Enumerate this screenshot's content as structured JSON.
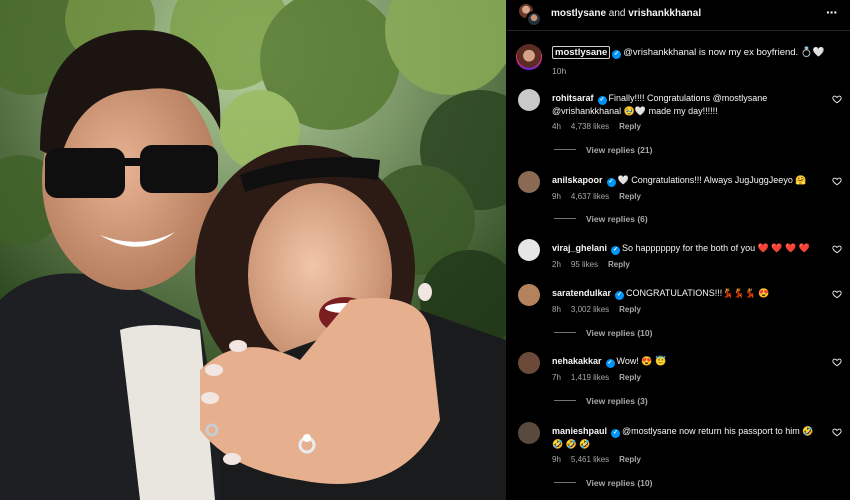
{
  "post": {
    "header": {
      "user1": "mostlysane",
      "joiner": " and ",
      "user2": "vrishankkhanal",
      "more_icon": "more-horizontal-icon"
    },
    "caption": {
      "username": "mostlysane",
      "text": "@vrishankkhanal is now my ex boyfriend. 💍🤍",
      "time": "10h"
    }
  },
  "comments": [
    {
      "username": "rohitsaraf",
      "verified": true,
      "text": "Finally!!!! Congratulations @mostlysane @vrishankkhanal 🥹🤍 made my day!!!!!!",
      "time": "4h",
      "likes": "4,738 likes",
      "reply_label": "Reply",
      "replies": "View replies (21)",
      "avatar_color": "#c9c9c9"
    },
    {
      "username": "anilskapoor",
      "verified": true,
      "text": "🤍 Congratulations!!! Always JugJuggJeeyo 🤗",
      "time": "9h",
      "likes": "4,637 likes",
      "reply_label": "Reply",
      "replies": "View replies (6)",
      "avatar_color": "#8a6a52"
    },
    {
      "username": "viraj_ghelani",
      "verified": true,
      "text": "So happppppy for the both of you ❤️ ❤️ ❤️ ❤️",
      "time": "2h",
      "likes": "95 likes",
      "reply_label": "Reply",
      "replies": "",
      "avatar_color": "#e6e6e6"
    },
    {
      "username": "saratendulkar",
      "verified": true,
      "text": "CONGRATULATIONS!!!💃💃💃 😍",
      "time": "8h",
      "likes": "3,002 likes",
      "reply_label": "Reply",
      "replies": "View replies (10)",
      "avatar_color": "#b5825e"
    },
    {
      "username": "nehakakkar",
      "verified": true,
      "text": "Wow! 😍 😇",
      "time": "7h",
      "likes": "1,419 likes",
      "reply_label": "Reply",
      "replies": "View replies (3)",
      "avatar_color": "#6b4a3a"
    },
    {
      "username": "manieshpaul",
      "verified": true,
      "text": "@mostlysane now return his passport to him 🤣 🤣 🤣 🤣",
      "time": "9h",
      "likes": "5,461 likes",
      "reply_label": "Reply",
      "replies": "View replies (10)",
      "avatar_color": "#5a4a3e"
    }
  ],
  "icons": {
    "verified": "verified-badge-icon",
    "like": "heart-outline-icon"
  },
  "colors": {
    "background": "#000000",
    "text": "#f5f5f5",
    "muted": "#a8a8a8",
    "verified": "#0095f6"
  }
}
